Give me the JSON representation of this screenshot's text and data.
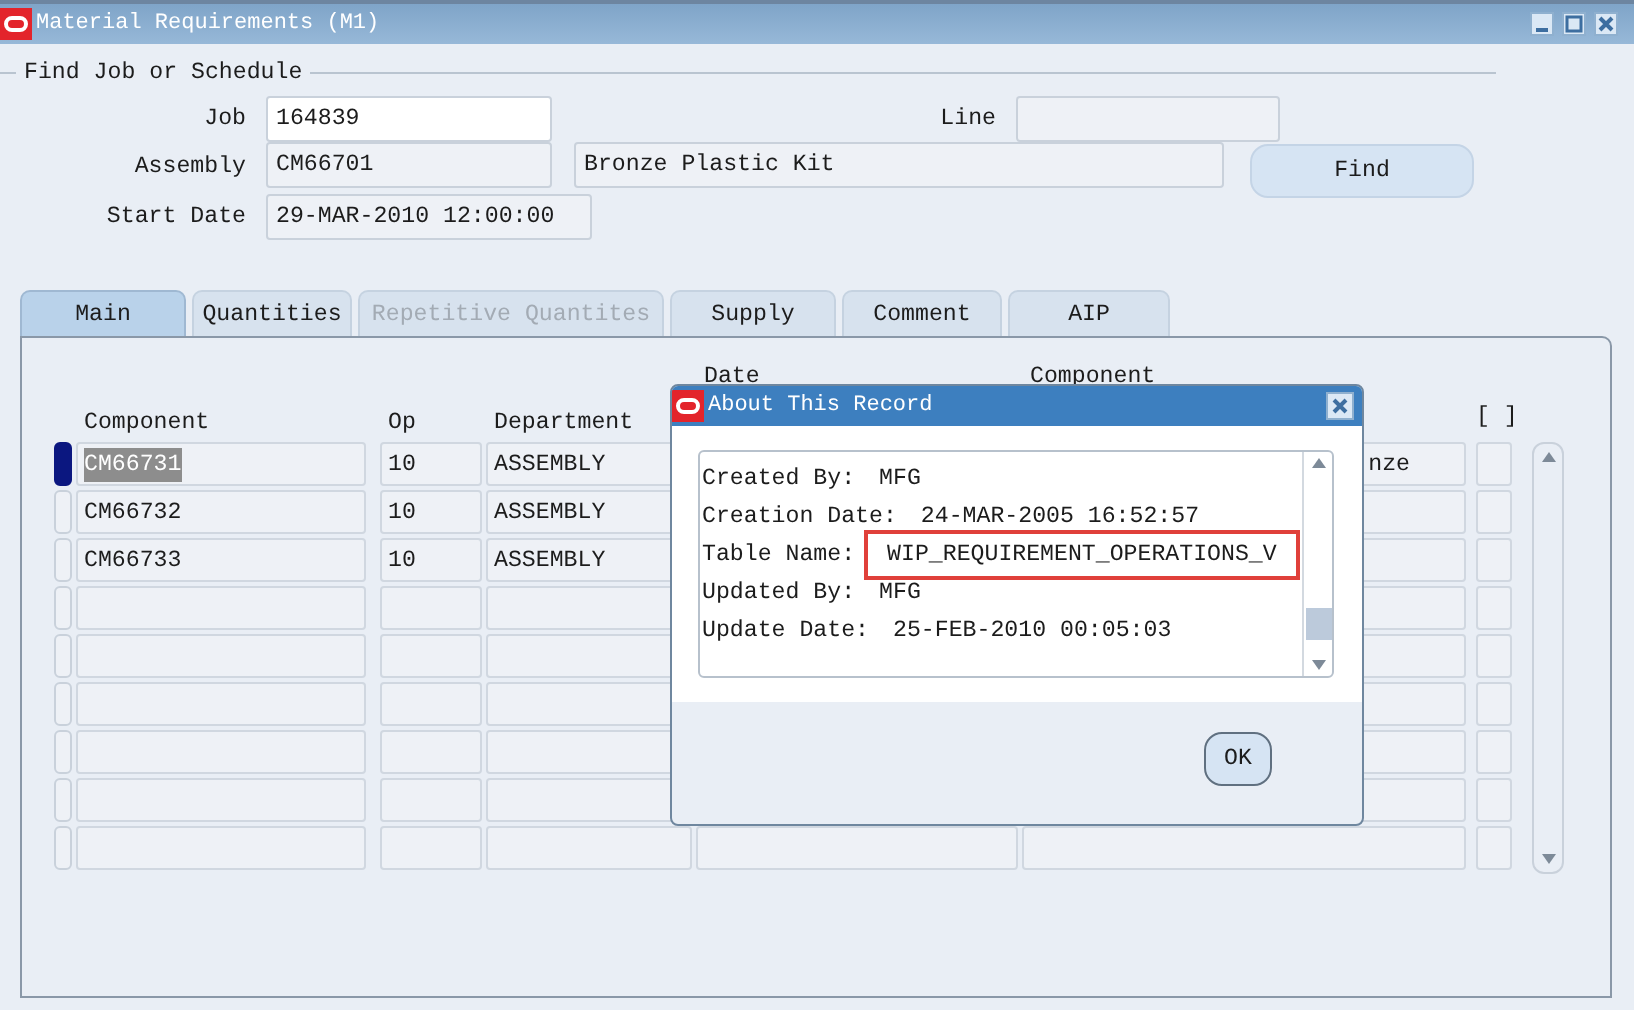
{
  "window": {
    "title": "Material Requirements (M1)"
  },
  "find_section": {
    "title": "Find Job or Schedule",
    "job": {
      "label": "Job",
      "value": "164839"
    },
    "line": {
      "label": "Line"
    },
    "assembly": {
      "label": "Assembly",
      "value": "CM66701",
      "description": "Bronze Plastic Kit"
    },
    "start_date": {
      "label": "Start Date",
      "value": "29-MAR-2010 12:00:00"
    },
    "find_button": "Find"
  },
  "tabs": [
    {
      "label": "Main",
      "selected": true,
      "disabled": false
    },
    {
      "label": "Quantities",
      "selected": false,
      "disabled": false
    },
    {
      "label": "Repetitive Quantites",
      "selected": false,
      "disabled": true
    },
    {
      "label": "Supply",
      "selected": false,
      "disabled": false
    },
    {
      "label": "Comment",
      "selected": false,
      "disabled": false
    },
    {
      "label": "AIP",
      "selected": false,
      "disabled": false
    }
  ],
  "table": {
    "columns": [
      "Component",
      "Op",
      "Department",
      "Date",
      "Component",
      "[ ]"
    ],
    "rows": [
      {
        "current": true,
        "text_selected": true,
        "component": "CM66731",
        "op": "10",
        "department": "ASSEMBLY",
        "column_5": "nze"
      },
      {
        "current": false,
        "text_selected": false,
        "component": "CM66732",
        "op": "10",
        "department": "ASSEMBLY"
      },
      {
        "current": false,
        "text_selected": false,
        "component": "CM66733",
        "op": "10",
        "department": "ASSEMBLY"
      }
    ]
  },
  "dialog": {
    "title": "About This Record",
    "lines": [
      {
        "label": "Created By:",
        "value": "MFG",
        "highlighted": false
      },
      {
        "label": "Creation Date:",
        "value": "24-MAR-2005 16:52:57",
        "highlighted": false
      },
      {
        "label": "Table Name:",
        "value": "WIP_REQUIREMENT_OPERATIONS_V",
        "highlighted": true
      },
      {
        "label": "Updated By:",
        "value": "MFG",
        "highlighted": false
      },
      {
        "label": "Update Date:",
        "value": "25-FEB-2010 00:05:03",
        "highlighted": false
      }
    ],
    "ok_button": "OK"
  }
}
